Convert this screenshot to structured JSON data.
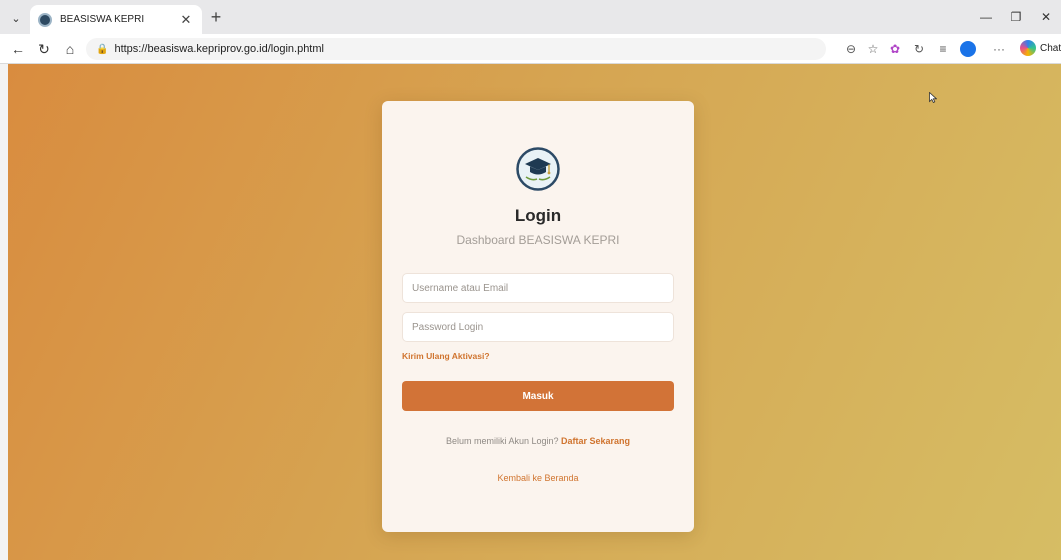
{
  "browser": {
    "tab_list_glyph": "⌄",
    "tab": {
      "title": "BEASISWA KEPRI",
      "close_glyph": "✕"
    },
    "new_tab_glyph": "+",
    "window": {
      "minimize": "—",
      "restore": "❐",
      "close": "✕"
    },
    "nav": {
      "back": "←",
      "reload": "↻",
      "home": "⌂"
    },
    "address": {
      "lock_glyph": "🔒",
      "url": "https://beasiswa.kepriprov.go.id/login.phtml"
    },
    "toolbar_icons": {
      "zoom": "⊖",
      "favorite": "☆",
      "extension": "✿",
      "refresh_ext": "↻",
      "collections": "≡",
      "more": "···"
    },
    "copilot_label": "Chat"
  },
  "login": {
    "title": "Login",
    "subtitle": "Dashboard BEASISWA KEPRI",
    "username_placeholder": "Username atau Email",
    "password_placeholder": "Password Login",
    "resend_label": "Kirim Ulang Aktivasi?",
    "submit_label": "Masuk",
    "register_prompt": "Belum memiliki Akun Login?",
    "register_link": "Daftar Sekarang",
    "home_link": "Kembali ke Beranda"
  },
  "colors": {
    "accent": "#d27337",
    "link": "#d0742f",
    "logo_ring": "#2c4a66"
  }
}
